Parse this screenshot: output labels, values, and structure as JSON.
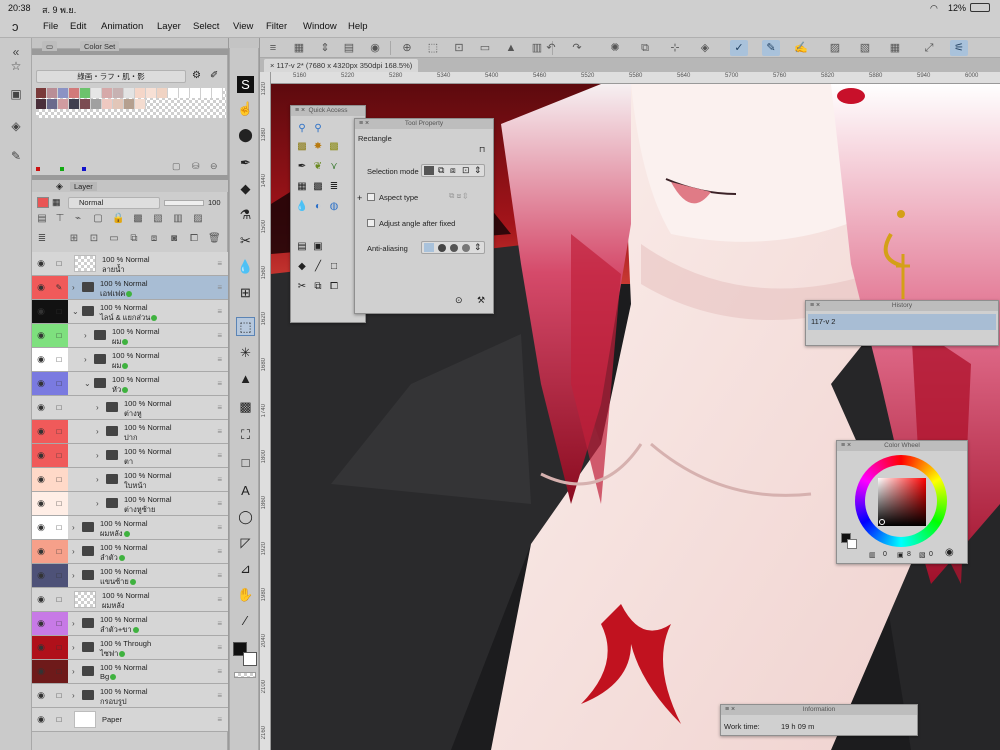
{
  "status": {
    "time": "20:38",
    "date": "ส. 9 พ.ย.",
    "battery": "12%"
  },
  "menu": [
    "File",
    "Edit",
    "Animation",
    "Layer",
    "Select",
    "View",
    "Filter",
    "Window",
    "Help"
  ],
  "color_set": {
    "tab": "Color Set",
    "set_name": "綠画・ラフ・肌・影",
    "swatches_row1": [
      "#7a3a3a",
      "#b98e96",
      "#8b93c4",
      "#d27a7a",
      "#6cc36c",
      "#e6e6e6",
      "#d6a9a9",
      "#c7b2b2",
      "#e3e3e3",
      "#f5d6c8",
      "#f7e0d5",
      "#f0d3c3",
      "#ffffff",
      "#ffffff",
      "#ffffff",
      "#ffffff",
      "#ffffff"
    ],
    "swatches_row2": [
      "#4a2f3a",
      "#6a6a8c",
      "#cf9ca0",
      "#3e3e4e",
      "#7b4c52",
      "#a0a0a0",
      "#efc9c1",
      "#e2c6b8",
      "#b5a08f",
      "#f4dcd0"
    ]
  },
  "layer_panel": {
    "title": "Layer",
    "blend": "Normal",
    "opacity": "100",
    "layers": [
      {
        "pct": "100 %",
        "mode": "Normal",
        "name": "ลายน้ำ",
        "kind": "thumb",
        "color": "#d6d6d6",
        "indent": 0,
        "caret": ""
      },
      {
        "pct": "100 %",
        "mode": "Normal",
        "name": "เอฟเฟค",
        "kind": "folder",
        "color": "#f05a5a",
        "indent": 0,
        "caret": "›",
        "dot": true,
        "selected": true
      },
      {
        "pct": "100 %",
        "mode": "Normal",
        "name": "ไลน์ & แยกส่วน",
        "kind": "folder",
        "color": "#111111",
        "indent": 0,
        "caret": "⌄",
        "dot": true
      },
      {
        "pct": "100 %",
        "mode": "Normal",
        "name": "ผม",
        "kind": "folder",
        "color": "#7ee07e",
        "indent": 1,
        "caret": "›",
        "dot": true
      },
      {
        "pct": "100 %",
        "mode": "Normal",
        "name": "ผม",
        "kind": "folder",
        "color": "#ffffff",
        "indent": 1,
        "caret": "›",
        "dot": true
      },
      {
        "pct": "100 %",
        "mode": "Normal",
        "name": "หัว",
        "kind": "folder",
        "color": "#7a7ae0",
        "indent": 1,
        "caret": "⌄",
        "dot": true
      },
      {
        "pct": "100 %",
        "mode": "Normal",
        "name": "ต่างหู",
        "kind": "folder",
        "color": "#d6d6d6",
        "indent": 2,
        "caret": "›"
      },
      {
        "pct": "100 %",
        "mode": "Normal",
        "name": "ปาก",
        "kind": "folder",
        "color": "#f05a5a",
        "indent": 2,
        "caret": "›"
      },
      {
        "pct": "100 %",
        "mode": "Normal",
        "name": "ตา",
        "kind": "folder",
        "color": "#f05a5a",
        "indent": 2,
        "caret": "›"
      },
      {
        "pct": "100 %",
        "mode": "Normal",
        "name": "ใบหน้า",
        "kind": "folder",
        "color": "#ffd9c8",
        "indent": 2,
        "caret": "›"
      },
      {
        "pct": "100 %",
        "mode": "Normal",
        "name": "ต่างหูซ้าย",
        "kind": "folder",
        "color": "#ffeee6",
        "indent": 2,
        "caret": "›"
      },
      {
        "pct": "100 %",
        "mode": "Normal",
        "name": "ผมหลัง",
        "kind": "folder",
        "color": "#ffffff",
        "indent": 0,
        "caret": "›",
        "dot": true
      },
      {
        "pct": "100 %",
        "mode": "Normal",
        "name": "ลำตัว",
        "kind": "folder",
        "color": "#f6a08a",
        "indent": 0,
        "caret": "›",
        "dot": true
      },
      {
        "pct": "100 %",
        "mode": "Normal",
        "name": "แขนซ้าย",
        "kind": "folder",
        "color": "#4e5278",
        "indent": 0,
        "caret": "›",
        "dot": true
      },
      {
        "pct": "100 %",
        "mode": "Normal",
        "name": "ผมหลัง",
        "kind": "thumb",
        "color": "#d6d6d6",
        "indent": 0,
        "caret": ""
      },
      {
        "pct": "100 %",
        "mode": "Normal",
        "name": "ลำตัว+ขา",
        "kind": "folder",
        "color": "#c77ae6",
        "indent": 0,
        "caret": "›",
        "dot": true
      },
      {
        "pct": "100 %",
        "mode": "Through",
        "name": "ไซฟา",
        "kind": "folder",
        "color": "#b0101a",
        "indent": 0,
        "caret": "›",
        "dot": true
      },
      {
        "pct": "100 %",
        "mode": "Normal",
        "name": "Bg",
        "kind": "folder",
        "color": "#6e1a1a",
        "indent": 0,
        "caret": "›",
        "dot": true
      },
      {
        "pct": "100 %",
        "mode": "Normal",
        "name": "กรอบรูป",
        "kind": "folder",
        "color": "#d6d6d6",
        "indent": 0,
        "caret": "›"
      },
      {
        "pct": "",
        "mode": "",
        "name": "Paper",
        "kind": "paper",
        "color": "#d6d6d6",
        "indent": 0,
        "caret": ""
      }
    ]
  },
  "canvas": {
    "tab": "117-v 2* (7680 x 4320px 350dpi 168.5%)",
    "ruler_top": [
      "5160",
      "5220",
      "5280",
      "5340",
      "5400",
      "5460",
      "5520",
      "5580",
      "5640",
      "5700",
      "5760",
      "5820",
      "5880",
      "5940",
      "6000",
      "6060"
    ],
    "ruler_left": [
      "1320",
      "1380",
      "1440",
      "1500",
      "1560",
      "1620",
      "1680",
      "1740",
      "1800",
      "1860",
      "1920",
      "1980",
      "2040",
      "2100",
      "2160"
    ]
  },
  "quick_access": {
    "title": "Quick Access"
  },
  "tool_property": {
    "title": "Tool Property",
    "tool_name": "Rectangle",
    "selection_mode": "Selection mode",
    "aspect_type": "Aspect type",
    "adjust_angle": "Adjust angle after fixed",
    "anti_aliasing": "Anti-aliasing"
  },
  "history": {
    "title": "History",
    "item": "117-v 2"
  },
  "color_wheel": {
    "title": "Color Wheel",
    "values": [
      "0",
      "8",
      "0"
    ]
  },
  "information": {
    "title": "Information",
    "label": "Work time:",
    "value": "19 h 09 m"
  }
}
